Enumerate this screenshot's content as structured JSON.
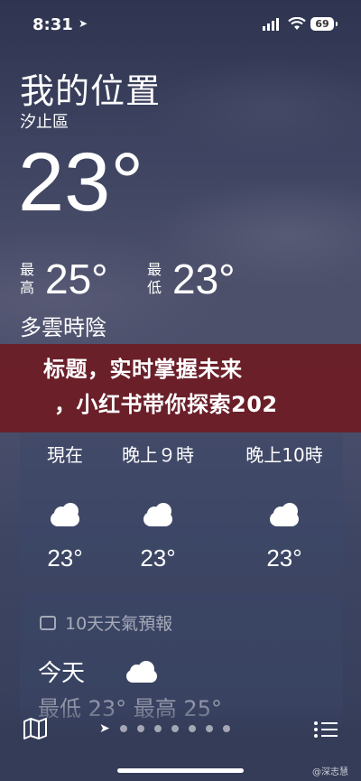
{
  "status_bar": {
    "time": "8:31",
    "battery": "69"
  },
  "location": {
    "title": "我的位置",
    "subtitle": "汐止區"
  },
  "current": {
    "temp": "23°",
    "high_label": "最\n高",
    "high": "25°",
    "low_label": "最\n低",
    "low": "23°",
    "condition": "多雲時陰"
  },
  "banner": {
    "line1": "标题，实时掌握未来",
    "line2": "，小红书带你探索202"
  },
  "hourly": [
    {
      "label": "現在",
      "icon": "cloud-icon",
      "temp": "23°"
    },
    {
      "label": "晚上９時",
      "icon": "cloud-icon",
      "temp": "23°"
    },
    {
      "label": "晚上10時",
      "icon": "cloud-icon",
      "temp": "23°"
    }
  ],
  "forecast": {
    "header": "10天天氣預報",
    "today_label": "今天",
    "today_range": "最低 23°  最高 25°"
  },
  "watermark": "@深志慧",
  "colors": {
    "banner": "#6e1920",
    "background": "#454a66"
  }
}
